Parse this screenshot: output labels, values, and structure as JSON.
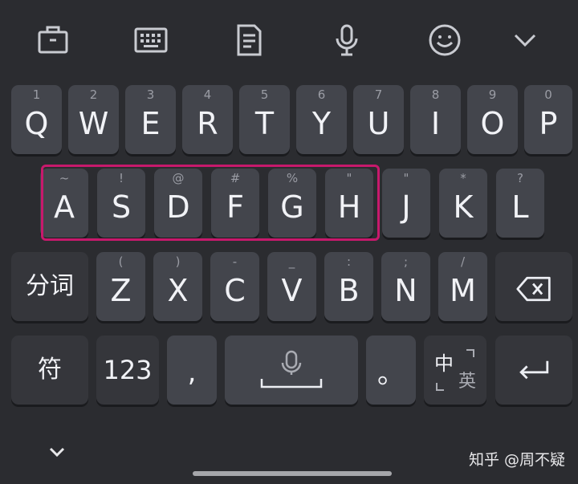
{
  "toolbar": {
    "icons": [
      "briefcase-icon",
      "keyboard-icon",
      "document-icon",
      "microphone-icon",
      "emoji-icon",
      "chevron-down-icon"
    ]
  },
  "row1": [
    {
      "key": "Q",
      "hint": "1"
    },
    {
      "key": "W",
      "hint": "2"
    },
    {
      "key": "E",
      "hint": "3"
    },
    {
      "key": "R",
      "hint": "4"
    },
    {
      "key": "T",
      "hint": "5"
    },
    {
      "key": "Y",
      "hint": "6"
    },
    {
      "key": "U",
      "hint": "7"
    },
    {
      "key": "I",
      "hint": "8"
    },
    {
      "key": "O",
      "hint": "9"
    },
    {
      "key": "P",
      "hint": "0"
    }
  ],
  "row2": [
    {
      "key": "A",
      "hint": "~"
    },
    {
      "key": "S",
      "hint": "!"
    },
    {
      "key": "D",
      "hint": "@"
    },
    {
      "key": "F",
      "hint": "#"
    },
    {
      "key": "G",
      "hint": "%"
    },
    {
      "key": "H",
      "hint": "\""
    },
    {
      "key": "J",
      "hint": "\""
    },
    {
      "key": "K",
      "hint": "*"
    },
    {
      "key": "L",
      "hint": "?"
    }
  ],
  "row3": {
    "segment": "分词",
    "letters": [
      {
        "key": "Z",
        "hint": "("
      },
      {
        "key": "X",
        "hint": ")"
      },
      {
        "key": "C",
        "hint": "-"
      },
      {
        "key": "V",
        "hint": "_"
      },
      {
        "key": "B",
        "hint": ":"
      },
      {
        "key": "N",
        "hint": ";"
      },
      {
        "key": "M",
        "hint": "/"
      }
    ]
  },
  "row4": {
    "symbol": "符",
    "numbers": "123",
    "comma": ",",
    "period": "。",
    "lang_zh": "中",
    "lang_en": "英"
  },
  "watermark": "知乎 @周不疑",
  "colors": {
    "background": "#2b2c30",
    "key": "#43454c",
    "key_dark": "#35363b",
    "highlight": "#c7196c"
  }
}
